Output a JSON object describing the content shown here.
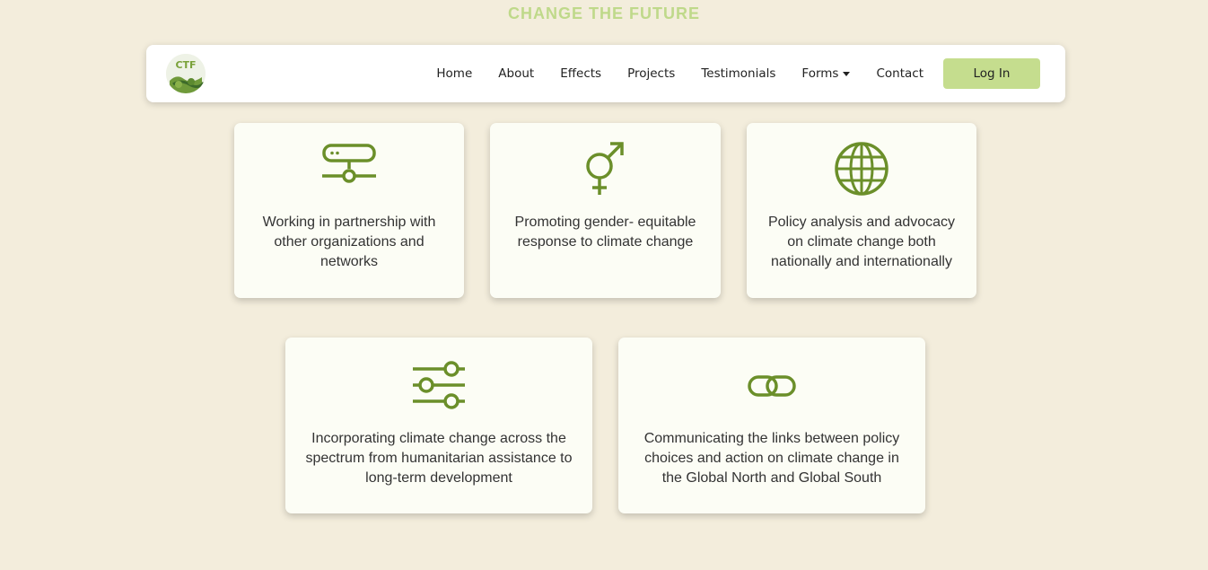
{
  "hero": {
    "title": "CHANGE THE FUTURE"
  },
  "navbar": {
    "logo_text": "CTF",
    "links": [
      "Home",
      "About",
      "Effects",
      "Projects",
      "Testimonials",
      "Forms",
      "Contact"
    ],
    "login_label": "Log In"
  },
  "cards": [
    {
      "icon": "network-icon",
      "text": "Working in partnership with other organizations and networks"
    },
    {
      "icon": "gender-icon",
      "text": "Promoting gender- equitable response to climate change"
    },
    {
      "icon": "globe-icon",
      "text": "Policy analysis and advocacy on climate change both nationally and internationally"
    },
    {
      "icon": "sliders-icon",
      "text": "Incorporating climate change across the spectrum from humanitarian assistance to long-term development"
    },
    {
      "icon": "link-icon",
      "text": "Communicating the links between policy choices and action on climate change in the Global North and Global South"
    }
  ],
  "colors": {
    "accent": "#6b8f2a",
    "button": "#c5dd8e",
    "background": "#f3eddc",
    "title": "#bfd98a"
  }
}
